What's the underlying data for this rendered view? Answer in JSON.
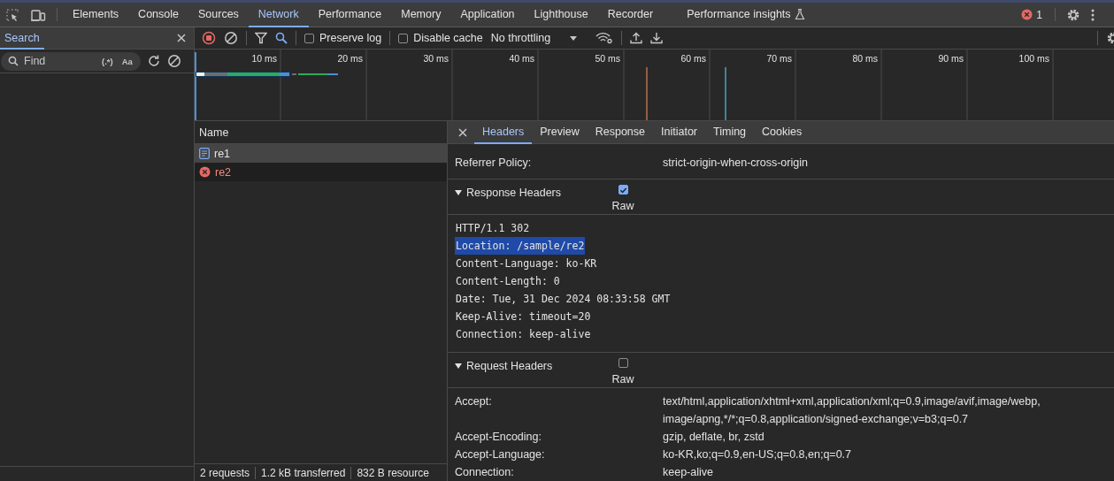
{
  "top_tabs": [
    {
      "label": "Elements",
      "selected": false,
      "kind": "plain"
    },
    {
      "label": "Console",
      "selected": false,
      "kind": "plain"
    },
    {
      "label": "Sources",
      "selected": false,
      "kind": "plain"
    },
    {
      "label": "Network",
      "selected": true,
      "kind": "plain"
    },
    {
      "label": "Performance",
      "selected": false,
      "kind": "plain"
    },
    {
      "label": "Memory",
      "selected": false,
      "kind": "plain"
    },
    {
      "label": "Application",
      "selected": false,
      "kind": "plain"
    },
    {
      "label": "Lighthouse",
      "selected": false,
      "kind": "plain"
    },
    {
      "label": "Recorder",
      "selected": false,
      "kind": "plain"
    },
    {
      "label": "Performance insights",
      "selected": false,
      "kind": "experiment"
    }
  ],
  "error_count": "1",
  "search_panel": {
    "title": "Search",
    "find": {
      "placeholder": "Find"
    },
    "regex_toggle": "(.*)",
    "case_toggle": "Aa"
  },
  "toolbar": {
    "recording": true,
    "search_active": true,
    "checkboxes": [
      {
        "label": "Preserve log",
        "checked": false
      },
      {
        "label": "Disable cache",
        "checked": false
      }
    ],
    "throttling": "No throttling"
  },
  "overview": {
    "ticks": [
      "10 ms",
      "20 ms",
      "30 ms",
      "40 ms",
      "50 ms",
      "60 ms",
      "70 ms",
      "80 ms",
      "90 ms",
      "100 ms"
    ]
  },
  "requests": {
    "column": "Name",
    "rows": [
      {
        "name": "re1",
        "kind": "document",
        "selected": true
      },
      {
        "name": "re2",
        "kind": "error",
        "selected": false
      }
    ]
  },
  "details": {
    "tabs": [
      {
        "label": "Headers",
        "selected": true
      },
      {
        "label": "Preview",
        "selected": false
      },
      {
        "label": "Response",
        "selected": false
      },
      {
        "label": "Initiator",
        "selected": false
      },
      {
        "label": "Timing",
        "selected": false
      },
      {
        "label": "Cookies",
        "selected": false
      }
    ],
    "general_rows": [
      {
        "name": "Referrer Policy:",
        "value": "strict-origin-when-cross-origin"
      }
    ],
    "sections": [
      {
        "title": "Response Headers",
        "expanded": true,
        "raw": {
          "label": "Raw",
          "checked": true
        },
        "kind": "raw",
        "lines": [
          {
            "text": "HTTP/1.1 302",
            "highlighted": false
          },
          {
            "text": "Location: /sample/re2",
            "highlighted": true
          },
          {
            "text": "Content-Language: ko-KR",
            "highlighted": false
          },
          {
            "text": "Content-Length: 0",
            "highlighted": false
          },
          {
            "text": "Date: Tue, 31 Dec 2024 08:33:58 GMT",
            "highlighted": false
          },
          {
            "text": "Keep-Alive: timeout=20",
            "highlighted": false
          },
          {
            "text": "Connection: keep-alive",
            "highlighted": false
          }
        ]
      },
      {
        "title": "Request Headers",
        "expanded": true,
        "raw": {
          "label": "Raw",
          "checked": false
        },
        "kind": "table",
        "rows": [
          {
            "name": "Accept:",
            "value": "text/html,application/xhtml+xml,application/xml;q=0.9,image/avif,image/webp,image/apng,*/*;q=0.8,application/signed-exchange;v=b3;q=0.7"
          },
          {
            "name": "Accept-Encoding:",
            "value": "gzip, deflate, br, zstd"
          },
          {
            "name": "Accept-Language:",
            "value": "ko-KR,ko;q=0.9,en-US;q=0.8,en;q=0.7"
          },
          {
            "name": "Connection:",
            "value": "keep-alive"
          }
        ]
      }
    ]
  },
  "status_bar": [
    "2 requests",
    "1.2 kB transferred",
    "832 B resource"
  ]
}
